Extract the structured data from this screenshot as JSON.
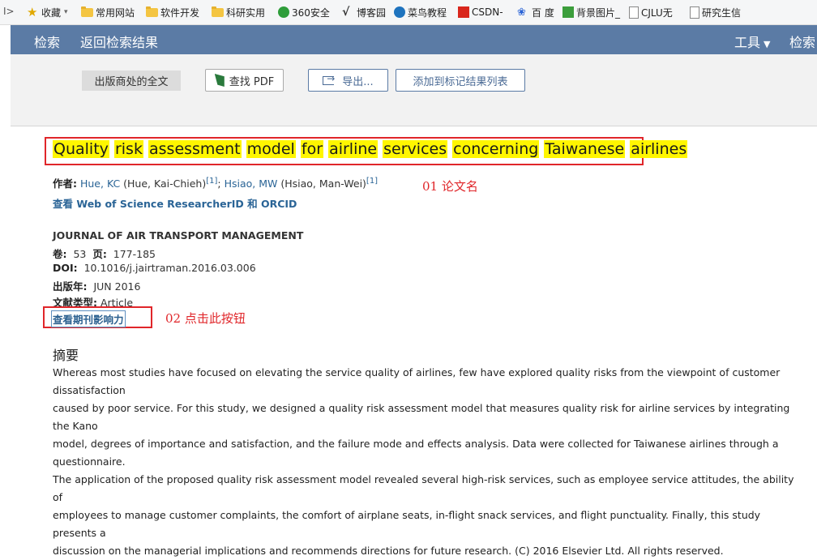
{
  "bookmarks": [
    {
      "label": "收藏",
      "icon": "star-icon"
    },
    {
      "label": "常用网站",
      "icon": "folder-icon"
    },
    {
      "label": "软件开发",
      "icon": "folder-icon"
    },
    {
      "label": "科研实用",
      "icon": "folder-icon"
    },
    {
      "label": "360安全",
      "icon": "360-icon"
    },
    {
      "label": "博客园",
      "icon": "cnblogs-icon"
    },
    {
      "label": "菜鸟教程",
      "icon": "runoob-icon"
    },
    {
      "label": "CSDN-",
      "icon": "csdn-icon"
    },
    {
      "label": "百 度",
      "icon": "baidu-icon"
    },
    {
      "label": "背景图片_",
      "icon": "image-site-icon"
    },
    {
      "label": "CJLU无",
      "icon": "page-icon"
    },
    {
      "label": "研究生信",
      "icon": "page-icon"
    }
  ],
  "nav": {
    "search": "检索",
    "back": "返回检索结果",
    "tools": "工具",
    "search_right": "检索"
  },
  "toolbar": {
    "publisher_fulltext": "出版商处的全文",
    "find_pdf": "查找 PDF",
    "export": "导出...",
    "add_marked": "添加到标记结果列表"
  },
  "record": {
    "title_words": [
      "Quality",
      "risk",
      "assessment",
      "model",
      "for",
      "airline",
      "services",
      "concerning",
      "Taiwanese",
      "airlines"
    ],
    "authors_label": "作者:",
    "author1_link": "Hue, KC",
    "author1_full": " (Hue, Kai-Chieh)",
    "author1_ref": "[1]",
    "sep": "; ",
    "author2_link": "Hsiao, MW",
    "author2_full": " (Hsiao, Man-Wei)",
    "author2_ref": "[1]",
    "researcher_link": "查看 Web of Science ResearcherID 和 ORCID",
    "journal": "JOURNAL OF AIR TRANSPORT MANAGEMENT",
    "volume_label": "卷:",
    "volume": "53",
    "pages_label": "页:",
    "pages": "177-185",
    "doi_label": "DOI:",
    "doi": "10.1016/j.jairtraman.2016.03.006",
    "pubdate_label": "出版年:",
    "pubdate": "JUN 2016",
    "doctype_label": "文献类型:",
    "doctype": "Article",
    "impact_link": "查看期刊影响力",
    "abstract_heading": "摘要",
    "abstract_lines": [
      "Whereas most studies have focused on elevating the service quality of airlines, few have explored quality risks from the viewpoint of customer dissatisfaction",
      "caused by poor service. For this study, we designed a quality risk assessment model that measures quality risk for airline services by integrating the Kano",
      "model, degrees of importance and satisfaction, and the failure mode and effects analysis. Data were collected for Taiwanese airlines through a questionnaire.",
      "The application of the proposed quality risk assessment model revealed several high-risk services, such as employee service attitudes, the ability of",
      "employees to manage customer complaints, the comfort of airplane seats, in-flight snack services, and flight punctuality. Finally, this study presents a",
      "discussion on the managerial implications and recommends directions for future research. (C) 2016 Elsevier Ltd. All rights reserved."
    ]
  },
  "annotations": {
    "a1": "01  论文名",
    "a2": "02  点击此按钮"
  },
  "colors": {
    "nav_bg": "#5b7ba5",
    "highlight": "#fff600",
    "annotation_red": "#e0262a",
    "link": "#2a6496"
  }
}
